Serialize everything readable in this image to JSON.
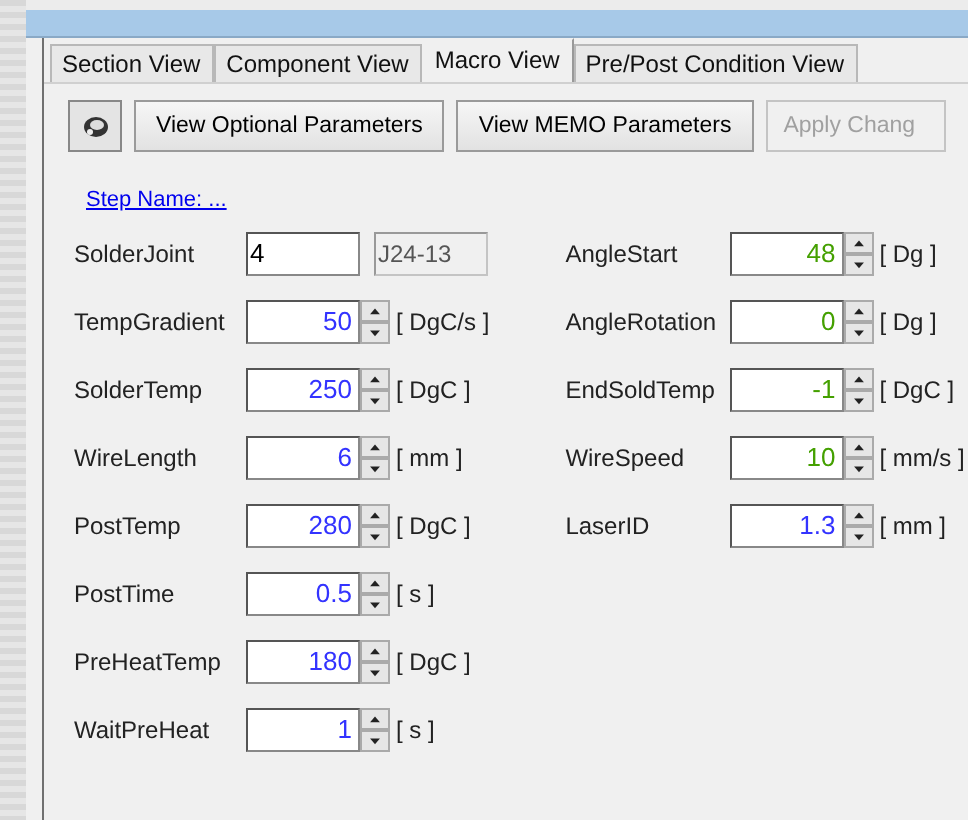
{
  "tabs": [
    {
      "label": "Section View",
      "selected": false
    },
    {
      "label": "Component View",
      "selected": false
    },
    {
      "label": "Macro View",
      "selected": true
    },
    {
      "label": "Pre/Post Condition View",
      "selected": false
    }
  ],
  "toolbar": {
    "buttons": [
      {
        "label": "View Optional Parameters",
        "disabled": false
      },
      {
        "label": "View MEMO Parameters",
        "disabled": false
      },
      {
        "label": "Apply Chang",
        "disabled": true
      }
    ]
  },
  "step_link": "Step Name: ...",
  "left_fields": [
    {
      "kind": "text",
      "label": "SolderJoint",
      "value": "4",
      "code": "J24-13",
      "color": "#000000"
    },
    {
      "kind": "spin",
      "label": "TempGradient",
      "value": "50",
      "unit": "[ DgC/s ]",
      "color": "#3333ff"
    },
    {
      "kind": "spin",
      "label": "SolderTemp",
      "value": "250",
      "unit": "[ DgC ]",
      "color": "#3333ff"
    },
    {
      "kind": "spin",
      "label": "WireLength",
      "value": "6",
      "unit": "[ mm ]",
      "color": "#3333ff"
    },
    {
      "kind": "spin",
      "label": "PostTemp",
      "value": "280",
      "unit": "[ DgC ]",
      "color": "#3333ff"
    },
    {
      "kind": "spin",
      "label": "PostTime",
      "value": "0.5",
      "unit": "[ s ]",
      "color": "#3333ff"
    },
    {
      "kind": "spin",
      "label": "PreHeatTemp",
      "value": "180",
      "unit": "[ DgC ]",
      "color": "#3333ff"
    },
    {
      "kind": "spin",
      "label": "WaitPreHeat",
      "value": "1",
      "unit": "[ s ]",
      "color": "#3333ff"
    }
  ],
  "right_fields": [
    {
      "kind": "spin",
      "label": "AngleStart",
      "value": "48",
      "unit": "[ Dg ]",
      "color": "#44a000"
    },
    {
      "kind": "spin",
      "label": "AngleRotation",
      "value": "0",
      "unit": "[ Dg ]",
      "color": "#44a000"
    },
    {
      "kind": "spin",
      "label": "EndSoldTemp",
      "value": "-1",
      "unit": "[ DgC ]",
      "color": "#44a000"
    },
    {
      "kind": "spin",
      "label": "WireSpeed",
      "value": "10",
      "unit": "[ mm/s ]",
      "color": "#44a000"
    },
    {
      "kind": "spin",
      "label": "LaserID",
      "value": "1.3",
      "unit": "[ mm ]",
      "color": "#3333ff"
    }
  ]
}
